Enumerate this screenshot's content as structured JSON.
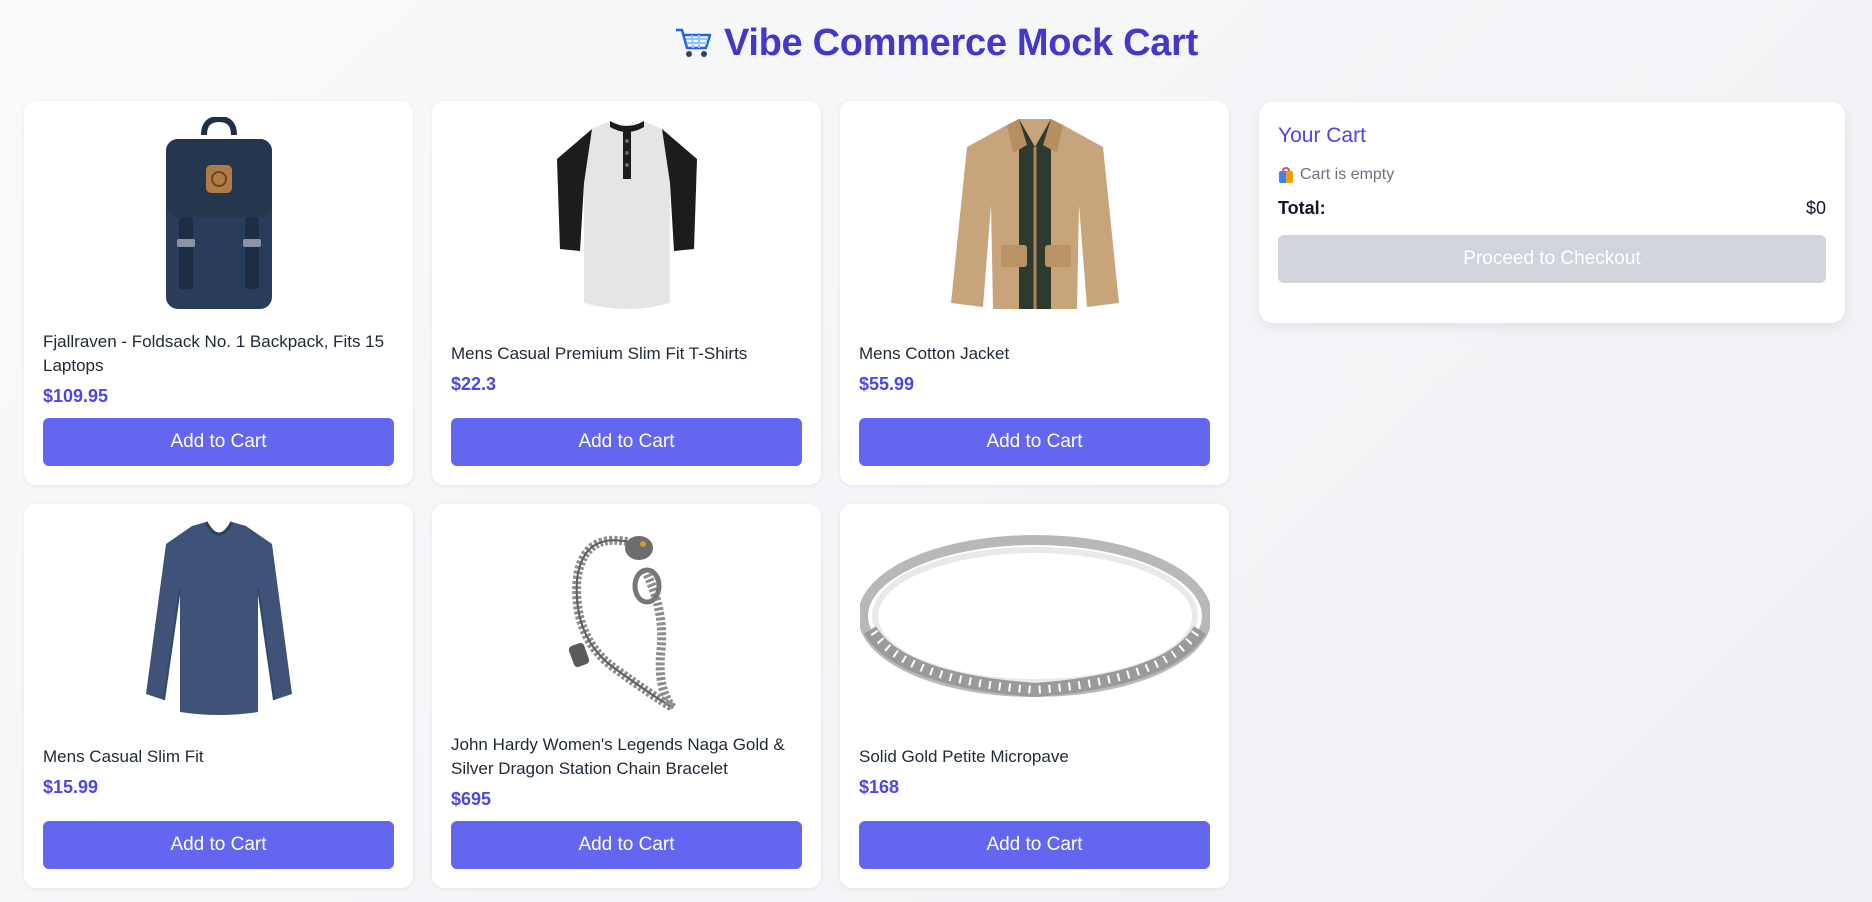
{
  "app": {
    "title": "Vibe Commerce Mock Cart",
    "title_icon": "shopping-cart-icon"
  },
  "products": [
    {
      "name": "Fjallraven - Foldsack No. 1 Backpack, Fits 15 Laptops",
      "price": "$109.95",
      "button": "Add to Cart",
      "image": "backpack-image"
    },
    {
      "name": "Mens Casual Premium Slim Fit T-Shirts",
      "price": "$22.3",
      "button": "Add to Cart",
      "image": "tshirt-image"
    },
    {
      "name": "Mens Cotton Jacket",
      "price": "$55.99",
      "button": "Add to Cart",
      "image": "jacket-image"
    },
    {
      "name": "Mens Casual Slim Fit",
      "price": "$15.99",
      "button": "Add to Cart",
      "image": "longsleeve-image"
    },
    {
      "name": "John Hardy Women's Legends Naga Gold & Silver Dragon Station Chain Bracelet",
      "price": "$695",
      "button": "Add to Cart",
      "image": "bracelet-image"
    },
    {
      "name": "Solid Gold Petite Micropave",
      "price": "$168",
      "button": "Add to Cart",
      "image": "ring-image"
    }
  ],
  "cart": {
    "title": "Your Cart",
    "empty_text": "Cart is empty",
    "empty_icon": "shopping-bags-icon",
    "total_label": "Total:",
    "total_value": "$0",
    "checkout_label": "Proceed to Checkout",
    "checkout_enabled": false
  },
  "colors": {
    "accent": "#6366f1",
    "title": "#4338ca",
    "price": "#4f46e5",
    "disabled": "#d1d5db"
  }
}
